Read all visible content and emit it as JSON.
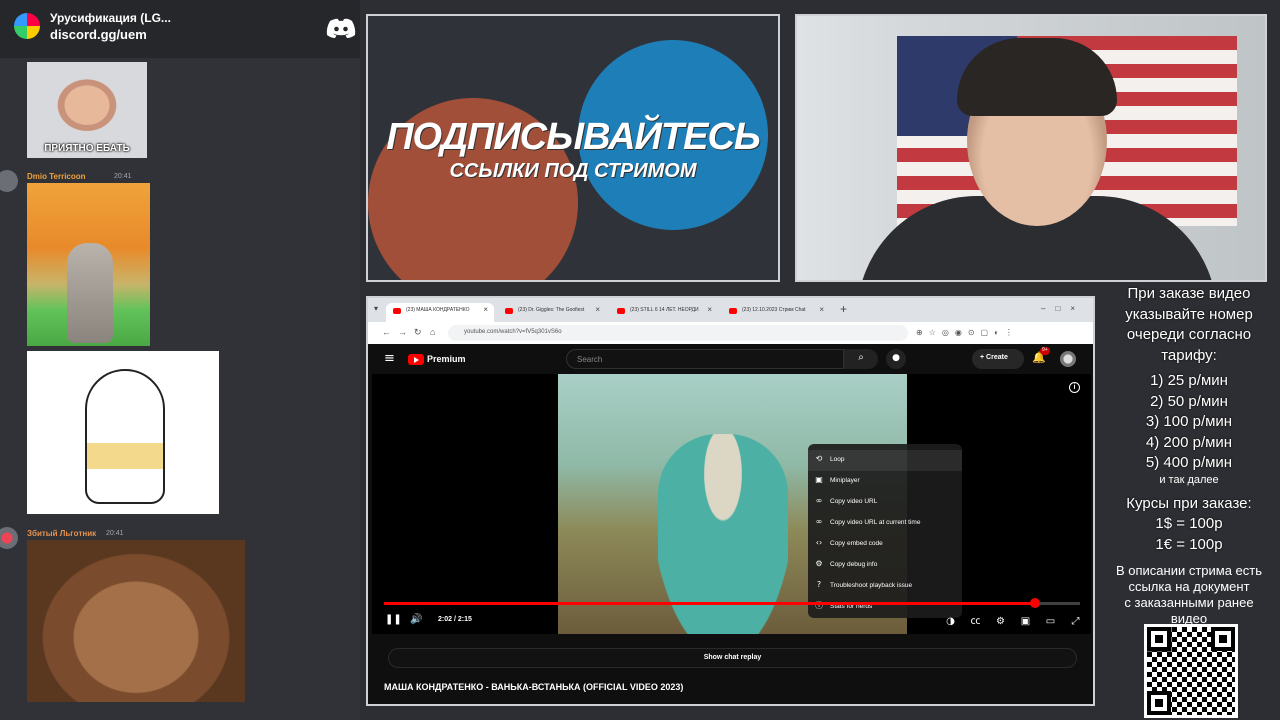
{
  "discord": {
    "server_name": "Урусификация (LG...",
    "invite": "discord.gg/uem",
    "messages": [
      {
        "image_caption": "ПРИЯТНО ЕБАТЬ"
      },
      {
        "user": "Dmio Terricoon",
        "time": "20:41"
      },
      {
        "user": "Збитый Льгoтник",
        "time": "20:41"
      }
    ]
  },
  "banner": {
    "title": "ПОДПИСЫВАЙТЕСЬ",
    "subtitle": "ССЫЛКИ ПОД СТРИМОМ"
  },
  "browser": {
    "tabs": [
      {
        "label": "(23) МАША КОНДРАТЕНКО"
      },
      {
        "label": "(23) Dr. Giggles: The Goofiest"
      },
      {
        "label": "(23) STILL 6 14 ЛЕТ. НЕОРДИ"
      },
      {
        "label": "(23) 12.10.2023 Стрим Chat"
      }
    ],
    "url": "youtube.com/watch?v=fV5q301vS6o"
  },
  "youtube": {
    "brand": "Premium",
    "search_placeholder": "Search",
    "create_label": "Create",
    "notification_badge": "9+",
    "time_display": "2:02 / 2:15",
    "progress_fraction": 0.936,
    "show_chat_replay": "Show chat replay",
    "video_title": "МАША КОНДРАТЕНКО - ВАНЬКА-ВСТАНЬКА (OFFICIAL VIDEO 2023)",
    "context_menu": [
      {
        "label": "Loop",
        "icon": "loop-icon"
      },
      {
        "label": "Miniplayer",
        "icon": "miniplayer-icon"
      },
      {
        "label": "Copy video URL",
        "icon": "link-icon"
      },
      {
        "label": "Copy video URL at current time",
        "icon": "link-icon"
      },
      {
        "label": "Copy embed code",
        "icon": "code-icon"
      },
      {
        "label": "Copy debug info",
        "icon": "gear-icon"
      },
      {
        "label": "Troubleshoot playback issue",
        "icon": "help-icon"
      },
      {
        "label": "Stats for nerds",
        "icon": "info-icon"
      }
    ]
  },
  "info_panel": {
    "intro": [
      "При заказе видео",
      "указывайте номер",
      "очереди согласно",
      "тарифу:"
    ],
    "tariffs": [
      "1) 25 р/мин",
      "2) 50 р/мин",
      "3) 100 р/мин",
      "4) 200 р/мин",
      "5) 400 р/мин"
    ],
    "tariffs_more": "и так далее",
    "rates_title": "Курсы при заказе:",
    "rates": [
      "1$ = 100р",
      "1€ = 100р"
    ],
    "description": [
      "В описании стрима есть",
      "ссылка на документ",
      "с заказанными ранее",
      "видео"
    ]
  }
}
